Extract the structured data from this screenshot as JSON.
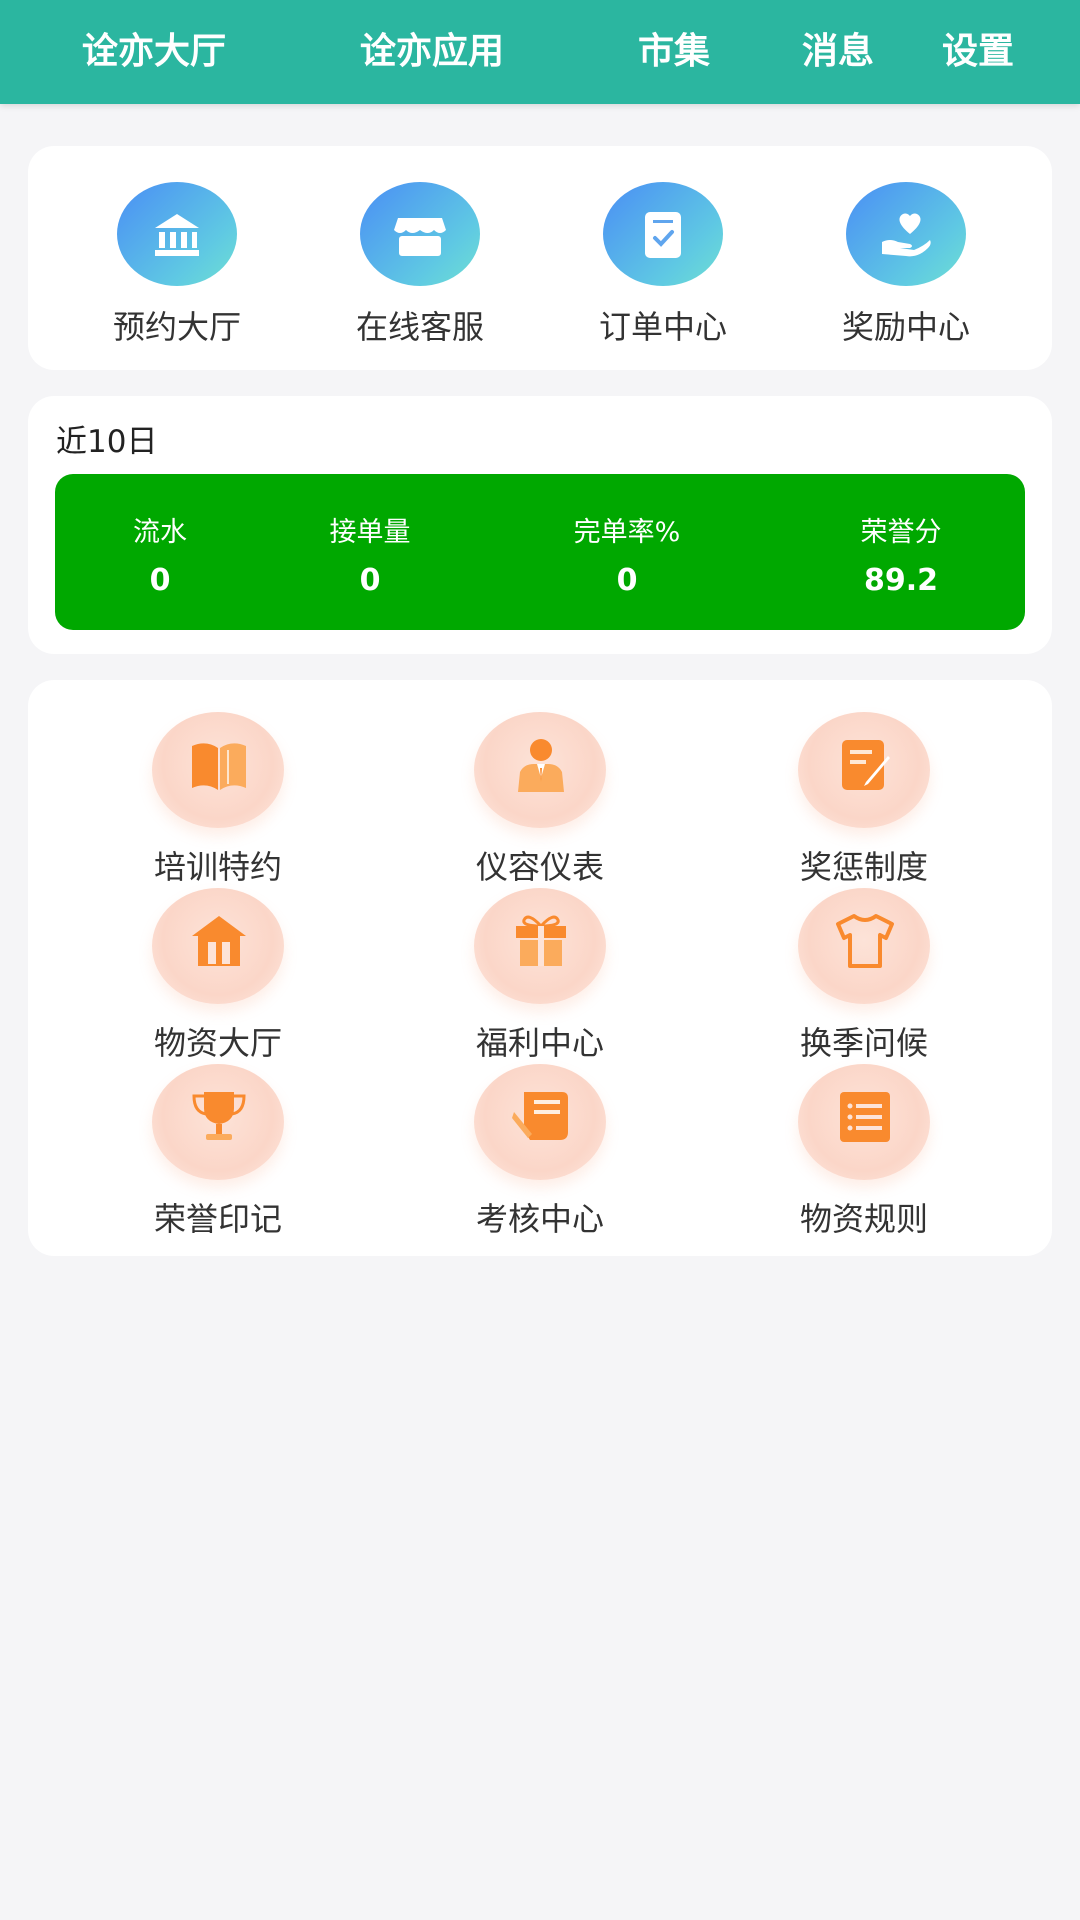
{
  "nav": {
    "tabs": [
      "诠亦大厅",
      "诠亦应用",
      "市集",
      "消息",
      "设置"
    ]
  },
  "quick": [
    {
      "label": "预约大厅",
      "icon": "building-icon"
    },
    {
      "label": "在线客服",
      "icon": "shop-icon"
    },
    {
      "label": "订单中心",
      "icon": "order-check-icon"
    },
    {
      "label": "奖励中心",
      "icon": "heart-hand-icon"
    }
  ],
  "stats": {
    "title": "近10日",
    "items": [
      {
        "label": "流水",
        "value": "0"
      },
      {
        "label": "接单量",
        "value": "0"
      },
      {
        "label": "完单率%",
        "value": "0"
      },
      {
        "label": "荣誉分",
        "value": "89.2"
      }
    ]
  },
  "grid": [
    {
      "label": "培训特约",
      "icon": "book-icon"
    },
    {
      "label": "仪容仪表",
      "icon": "person-suit-icon"
    },
    {
      "label": "奖惩制度",
      "icon": "note-edit-icon"
    },
    {
      "label": "物资大厅",
      "icon": "house-icon"
    },
    {
      "label": "福利中心",
      "icon": "gift-icon"
    },
    {
      "label": "换季问候",
      "icon": "shirt-icon"
    },
    {
      "label": "荣誉印记",
      "icon": "trophy-icon"
    },
    {
      "label": "考核中心",
      "icon": "exam-icon"
    },
    {
      "label": "物资规则",
      "icon": "list-icon"
    }
  ],
  "colors": {
    "header": "#2bb6a0",
    "stats_bg": "#00a800",
    "accent_orange": "#f98a2e",
    "accent_blue": "#4a8ef5"
  }
}
